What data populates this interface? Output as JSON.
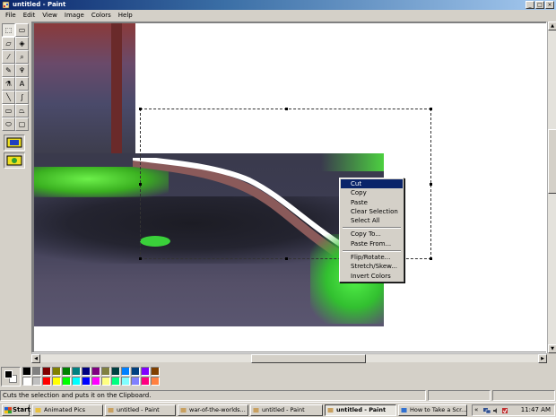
{
  "window": {
    "title": "untitled - Paint",
    "controls": [
      "_",
      "□",
      "×"
    ]
  },
  "menu": [
    "File",
    "Edit",
    "View",
    "Image",
    "Colors",
    "Help"
  ],
  "toolbox": {
    "tools": [
      {
        "name": "free-form-select-icon",
        "glyph": "⬚"
      },
      {
        "name": "select-icon",
        "glyph": "▭"
      },
      {
        "name": "eraser-icon",
        "glyph": "▱"
      },
      {
        "name": "fill-bucket-icon",
        "glyph": "◈"
      },
      {
        "name": "pick-color-icon",
        "glyph": "⁄"
      },
      {
        "name": "magnifier-icon",
        "glyph": "⌕"
      },
      {
        "name": "pencil-icon",
        "glyph": "✎"
      },
      {
        "name": "brush-icon",
        "glyph": "♆"
      },
      {
        "name": "airbrush-icon",
        "glyph": "⚗"
      },
      {
        "name": "text-icon",
        "glyph": "A"
      },
      {
        "name": "line-icon",
        "glyph": "╲"
      },
      {
        "name": "curve-icon",
        "glyph": "∫"
      },
      {
        "name": "rectangle-icon",
        "glyph": "▭"
      },
      {
        "name": "polygon-icon",
        "glyph": "⏢"
      },
      {
        "name": "ellipse-icon",
        "glyph": "⬭"
      },
      {
        "name": "rounded-rectangle-icon",
        "glyph": "▢"
      }
    ]
  },
  "context_menu": {
    "groups": [
      [
        "Cut",
        "Copy",
        "Paste",
        "Clear Selection",
        "Select All"
      ],
      [
        "Copy To...",
        "Paste From..."
      ],
      [
        "Flip/Rotate...",
        "Stretch/Skew...",
        "Invert Colors"
      ]
    ],
    "highlighted": "Cut"
  },
  "palette": {
    "foreground": "#000000",
    "background": "#ffffff",
    "colors": [
      "#000000",
      "#808080",
      "#800000",
      "#808000",
      "#008000",
      "#008080",
      "#000080",
      "#800080",
      "#808040",
      "#004040",
      "#0080ff",
      "#004080",
      "#8000ff",
      "#804000",
      "#ffffff",
      "#c0c0c0",
      "#ff0000",
      "#ffff00",
      "#00ff00",
      "#00ffff",
      "#0000ff",
      "#ff00ff",
      "#ffff80",
      "#00ff80",
      "#80ffff",
      "#8080ff",
      "#ff0080",
      "#ff8040"
    ]
  },
  "status": {
    "text": "Cuts the selection and puts it on the Clipboard."
  },
  "taskbar": {
    "start": "Start",
    "tasks": [
      {
        "label": "Animated Pics",
        "active": false,
        "icon": "folder-icon"
      },
      {
        "label": "untitled - Paint",
        "active": false,
        "icon": "paint-icon"
      },
      {
        "label": "war-of-the-worlds...",
        "active": false,
        "icon": "paint-icon"
      },
      {
        "label": "untitled - Paint",
        "active": false,
        "icon": "paint-icon"
      },
      {
        "label": "untitled - Paint",
        "active": true,
        "icon": "paint-icon"
      },
      {
        "label": "How to Take a Scr...",
        "active": false,
        "icon": "browser-icon"
      }
    ],
    "tray_chevron": "«",
    "clock": "11:47 AM"
  },
  "colors": {
    "title_active": "#0a246a",
    "menu_highlight": "#0a246a",
    "face": "#d4d0c8"
  }
}
